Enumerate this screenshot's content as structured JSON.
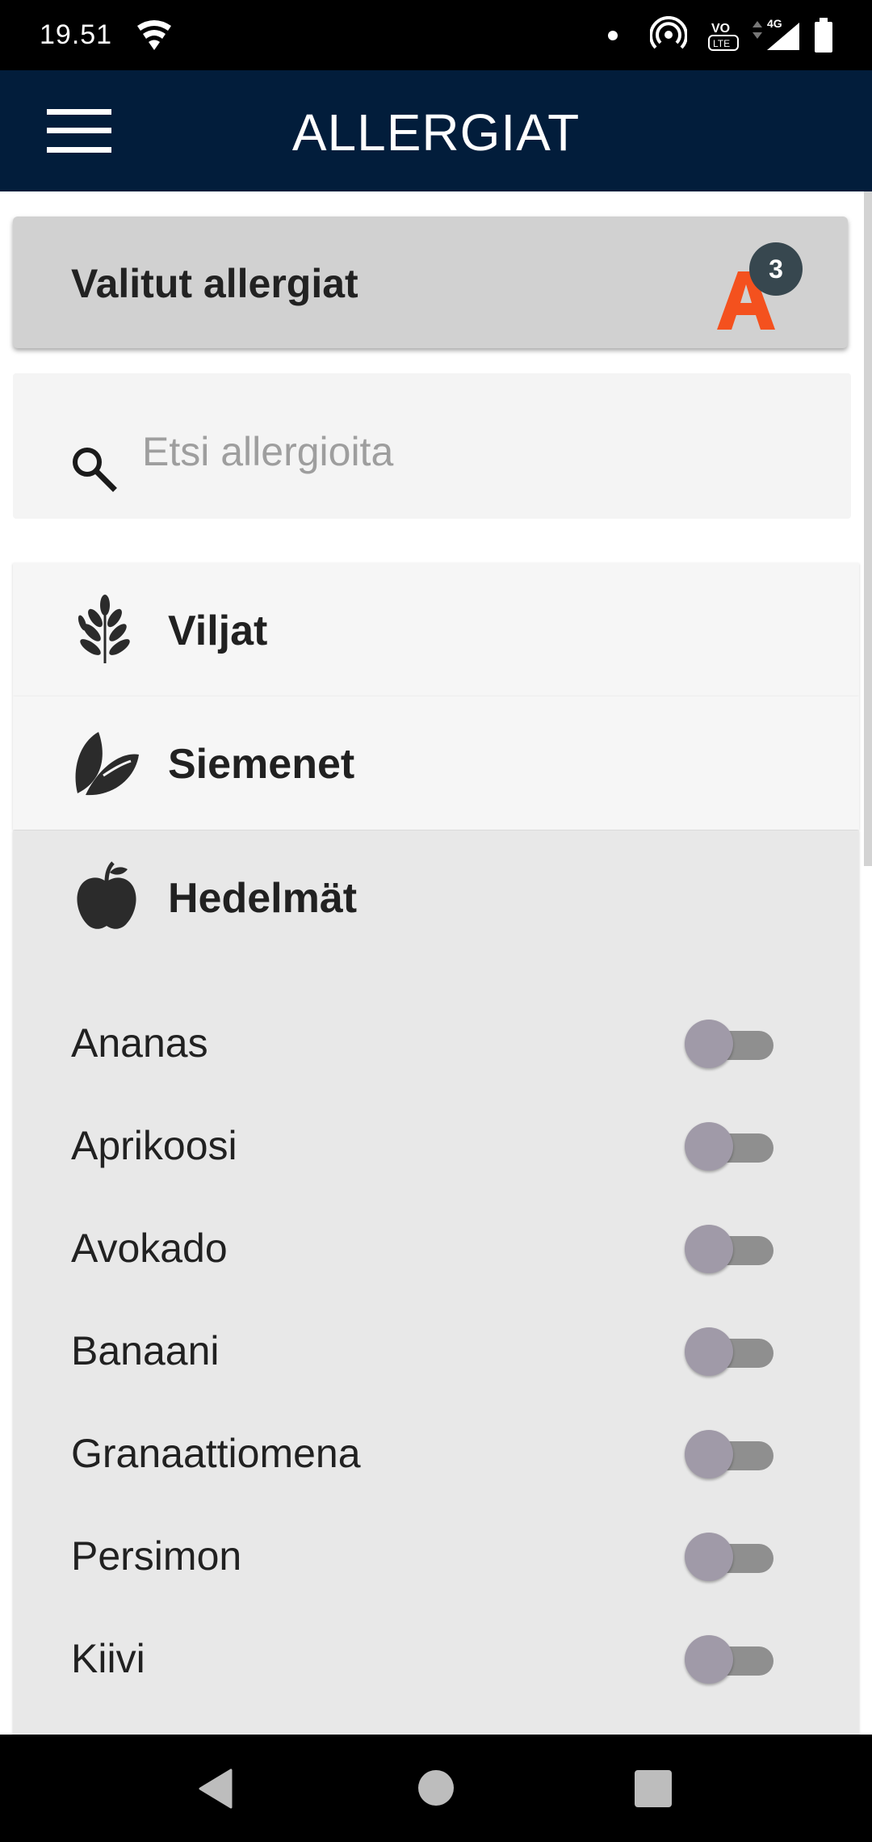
{
  "status_bar": {
    "time": "19.51",
    "volte_top": "VO",
    "volte_bottom": "LTE",
    "network": "4G"
  },
  "app_bar": {
    "title": "ALLERGIAT",
    "menu_icon": "hamburger-menu-icon"
  },
  "selected": {
    "label": "Valitut allergiat",
    "logo_letter": "A",
    "count": "3",
    "logo_color": "#f4511e"
  },
  "search": {
    "placeholder": "Etsi allergioita",
    "value": "",
    "icon": "search-icon"
  },
  "categories": [
    {
      "label": "Viljat",
      "icon": "wheat-icon",
      "expanded": false
    },
    {
      "label": "Siemenet",
      "icon": "seed-leaf-icon",
      "expanded": false
    },
    {
      "label": "Hedelmät",
      "icon": "apple-icon",
      "expanded": true
    }
  ],
  "fruits": [
    {
      "label": "Ananas",
      "checked": false
    },
    {
      "label": "Aprikoosi",
      "checked": false
    },
    {
      "label": "Avokado",
      "checked": false
    },
    {
      "label": "Banaani",
      "checked": false
    },
    {
      "label": "Granaattiomena",
      "checked": false
    },
    {
      "label": "Persimon",
      "checked": false
    },
    {
      "label": "Kiivi",
      "checked": false
    }
  ],
  "colors": {
    "app_bar": "#021d3b",
    "accent": "#f4511e",
    "badge": "#37474f"
  }
}
